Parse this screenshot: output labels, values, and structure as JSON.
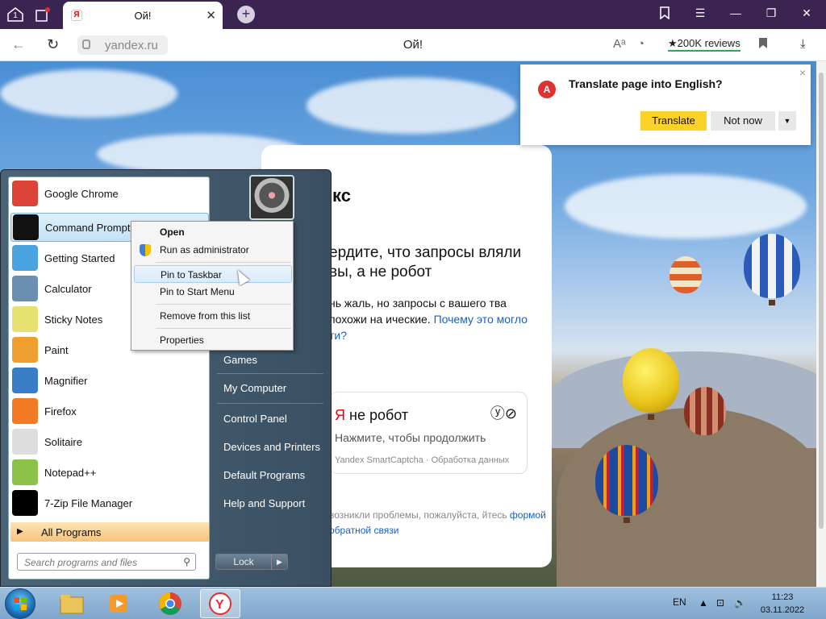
{
  "browser": {
    "tab": {
      "title": "Ой!",
      "favicon": "Я",
      "close": "✕"
    },
    "tabs_counter": "1",
    "new_tab": "+",
    "window_controls": {
      "collections": "collections-icon",
      "menu": "☰",
      "minimize": "—",
      "restore": "❐",
      "close": "✕"
    },
    "url": "yandex.ru",
    "page_title": "Ой!",
    "reviews": "★200K reviews"
  },
  "translate_popup": {
    "question": "Translate page into English?",
    "translate_label": "Translate",
    "not_now_label": "Not now",
    "close": "×"
  },
  "captcha_page": {
    "brand": "кс",
    "heading": "ердите, что запросы вляли вы, а не робот",
    "body_text": "нь жаль, но запросы с вашего тва похожи на ические.",
    "body_link": "Почему это могло ти?",
    "captcha_title_ya": "Я",
    "captcha_title": " не робот",
    "captcha_subtitle": "Нажмите, чтобы продолжить",
    "captcha_footer": "Yandex SmartCaptcha · Обработка данных",
    "captcha_logo": "ⓨ⊘",
    "footer_text": "возникли проблемы, пожалуйста, йтесь",
    "footer_link": "формой обратной связи"
  },
  "start_menu": {
    "programs": [
      {
        "label": "Google Chrome",
        "icon": "chrome-icon",
        "color": "#db4437"
      },
      {
        "label": "Command Prompt",
        "icon": "command-prompt-icon",
        "color": "#111111"
      },
      {
        "label": "Getting Started",
        "icon": "getting-started-icon",
        "color": "#4aa3df"
      },
      {
        "label": "Calculator",
        "icon": "calculator-icon",
        "color": "#6b8fb0"
      },
      {
        "label": "Sticky Notes",
        "icon": "sticky-notes-icon",
        "color": "#e8e070"
      },
      {
        "label": "Paint",
        "icon": "paint-icon",
        "color": "#f0a030"
      },
      {
        "label": "Magnifier",
        "icon": "magnifier-icon",
        "color": "#3a7ec8"
      },
      {
        "label": "Firefox",
        "icon": "firefox-icon",
        "color": "#f27a24"
      },
      {
        "label": "Solitaire",
        "icon": "solitaire-icon",
        "color": "#dddddd"
      },
      {
        "label": "Notepad++",
        "icon": "notepad-plus-plus-icon",
        "color": "#8bc34a"
      },
      {
        "label": "7-Zip File Manager",
        "icon": "7zip-icon",
        "color": "#000000"
      }
    ],
    "all_programs": "All Programs",
    "search_placeholder": "Search programs and files",
    "right_items": [
      "Games",
      "My Computer",
      "Control Panel",
      "Devices and Printers",
      "Default Programs",
      "Help and Support"
    ],
    "lock_label": "Lock"
  },
  "context_menu": {
    "items": [
      "Open",
      "Run as administrator",
      "Pin to Taskbar",
      "Pin to Start Menu",
      "Remove from this list",
      "Properties"
    ]
  },
  "taskbar": {
    "apps": [
      "file-explorer-icon",
      "media-player-icon",
      "chrome-icon",
      "yandex-browser-icon"
    ],
    "language": "EN",
    "time": "11:23",
    "date": "03.11.2022"
  }
}
